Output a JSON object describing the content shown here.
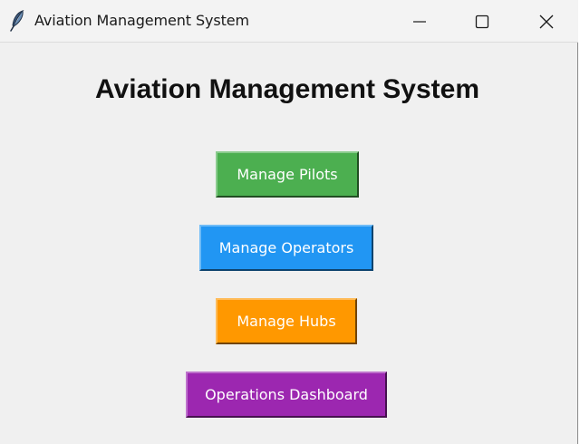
{
  "window": {
    "title": "Aviation Management System",
    "app_icon": "feather-icon",
    "controls": {
      "minimize_icon": "minimize-icon",
      "maximize_icon": "maximize-icon",
      "close_icon": "close-icon"
    }
  },
  "main": {
    "heading": "Aviation Management System",
    "buttons": [
      {
        "label": "Manage Pilots",
        "color": "#4caf50"
      },
      {
        "label": "Manage Operators",
        "color": "#2196f3"
      },
      {
        "label": "Manage Hubs",
        "color": "#ff9800"
      },
      {
        "label": "Operations Dashboard",
        "color": "#9c27b0"
      }
    ]
  }
}
